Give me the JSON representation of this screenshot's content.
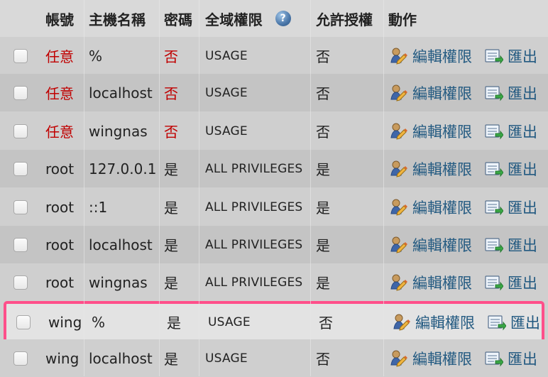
{
  "headers": {
    "account": "帳號",
    "host": "主機名稱",
    "password": "密碼",
    "global_privileges": "全域權限",
    "grant": "允許授權",
    "action": "動作"
  },
  "icons": {
    "help": "help-icon",
    "edit": "user-edit-icon",
    "export": "export-icon"
  },
  "rows": [
    {
      "user": "任意",
      "host": "%",
      "password": "否",
      "privileges": "USAGE",
      "grant": "否",
      "edit": "編輯權限",
      "export": "匯出",
      "user_red": true,
      "password_red": true
    },
    {
      "user": "任意",
      "host": "localhost",
      "password": "否",
      "privileges": "USAGE",
      "grant": "否",
      "edit": "編輯權限",
      "export": "匯出",
      "user_red": true,
      "password_red": true
    },
    {
      "user": "任意",
      "host": "wingnas",
      "password": "否",
      "privileges": "USAGE",
      "grant": "否",
      "edit": "編輯權限",
      "export": "匯出",
      "user_red": true,
      "password_red": true
    },
    {
      "user": "root",
      "host": "127.0.0.1",
      "password": "是",
      "privileges": "ALL PRIVILEGES",
      "grant": "是",
      "edit": "編輯權限",
      "export": "匯出"
    },
    {
      "user": "root",
      "host": "::1",
      "password": "是",
      "privileges": "ALL PRIVILEGES",
      "grant": "是",
      "edit": "編輯權限",
      "export": "匯出"
    },
    {
      "user": "root",
      "host": "localhost",
      "password": "是",
      "privileges": "ALL PRIVILEGES",
      "grant": "是",
      "edit": "編輯權限",
      "export": "匯出"
    },
    {
      "user": "root",
      "host": "wingnas",
      "password": "是",
      "privileges": "ALL PRIVILEGES",
      "grant": "是",
      "edit": "編輯權限",
      "export": "匯出"
    },
    {
      "user": "wing",
      "host": "%",
      "password": "是",
      "privileges": "USAGE",
      "grant": "否",
      "edit": "編輯權限",
      "export": "匯出"
    },
    {
      "user": "wing",
      "host": "localhost",
      "password": "是",
      "privileges": "USAGE",
      "grant": "否",
      "edit": "編輯權限",
      "export": "匯出"
    }
  ],
  "colors": {
    "selection_border": "#ff4f8a",
    "link": "#235a81",
    "red_text": "#c00000"
  }
}
